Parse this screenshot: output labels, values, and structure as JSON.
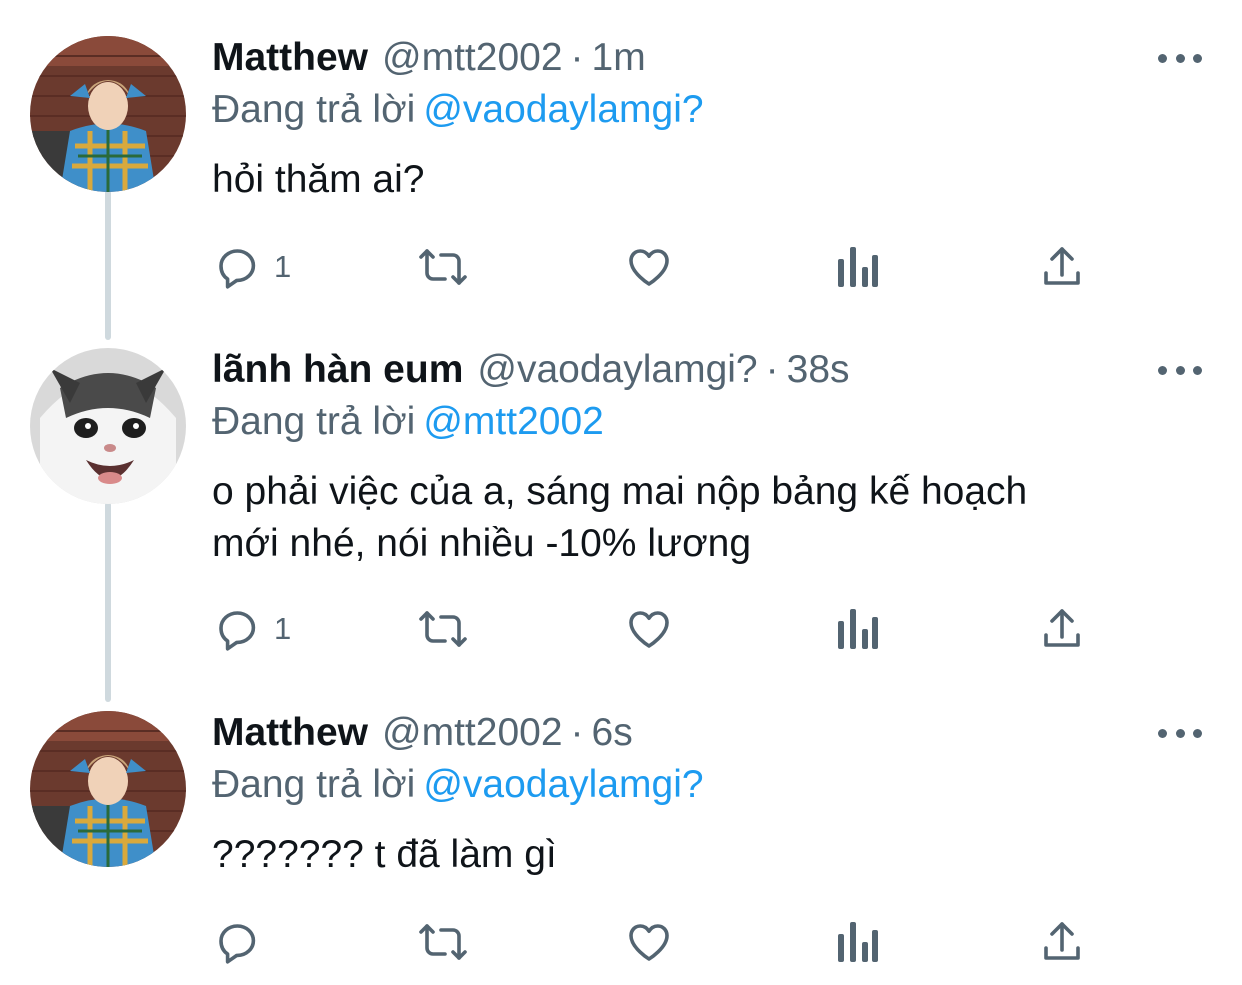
{
  "tweets": [
    {
      "name": "Matthew",
      "handle": "@mtt2002",
      "separator": "·",
      "time": "1m",
      "reply_prefix": "Đang trả lời",
      "reply_to": "@vaodaylamgi?",
      "lines": [
        "hỏi thăm ai?"
      ],
      "reply_count": "1",
      "avatar": "matthew-avatar"
    },
    {
      "name": "lãnh hàn eum",
      "handle": "@vaodaylamgi?",
      "separator": "·",
      "time": "38s",
      "reply_prefix": "Đang trả lời",
      "reply_to": "@mtt2002",
      "lines": [
        "o phải việc của a, sáng mai nộp bảng kế hoạch",
        "mới nhé, nói nhiều -10% lương"
      ],
      "reply_count": "1",
      "avatar": "cat-avatar"
    },
    {
      "name": "Matthew",
      "handle": "@mtt2002",
      "separator": "·",
      "time": "6s",
      "reply_prefix": "Đang trả lời",
      "reply_to": "@vaodaylamgi?",
      "lines": [
        "??????? t đã làm gì"
      ],
      "reply_count": "",
      "avatar": "matthew-avatar"
    }
  ],
  "icons": {
    "reply": "reply-icon",
    "retweet": "retweet-icon",
    "like": "heart-icon",
    "analytics": "analytics-icon",
    "share": "share-icon",
    "more": "more-icon"
  },
  "colors": {
    "text": "#0f1419",
    "secondary": "#536471",
    "mention": "#1d9bf0",
    "thread_line": "#cfd9de"
  }
}
